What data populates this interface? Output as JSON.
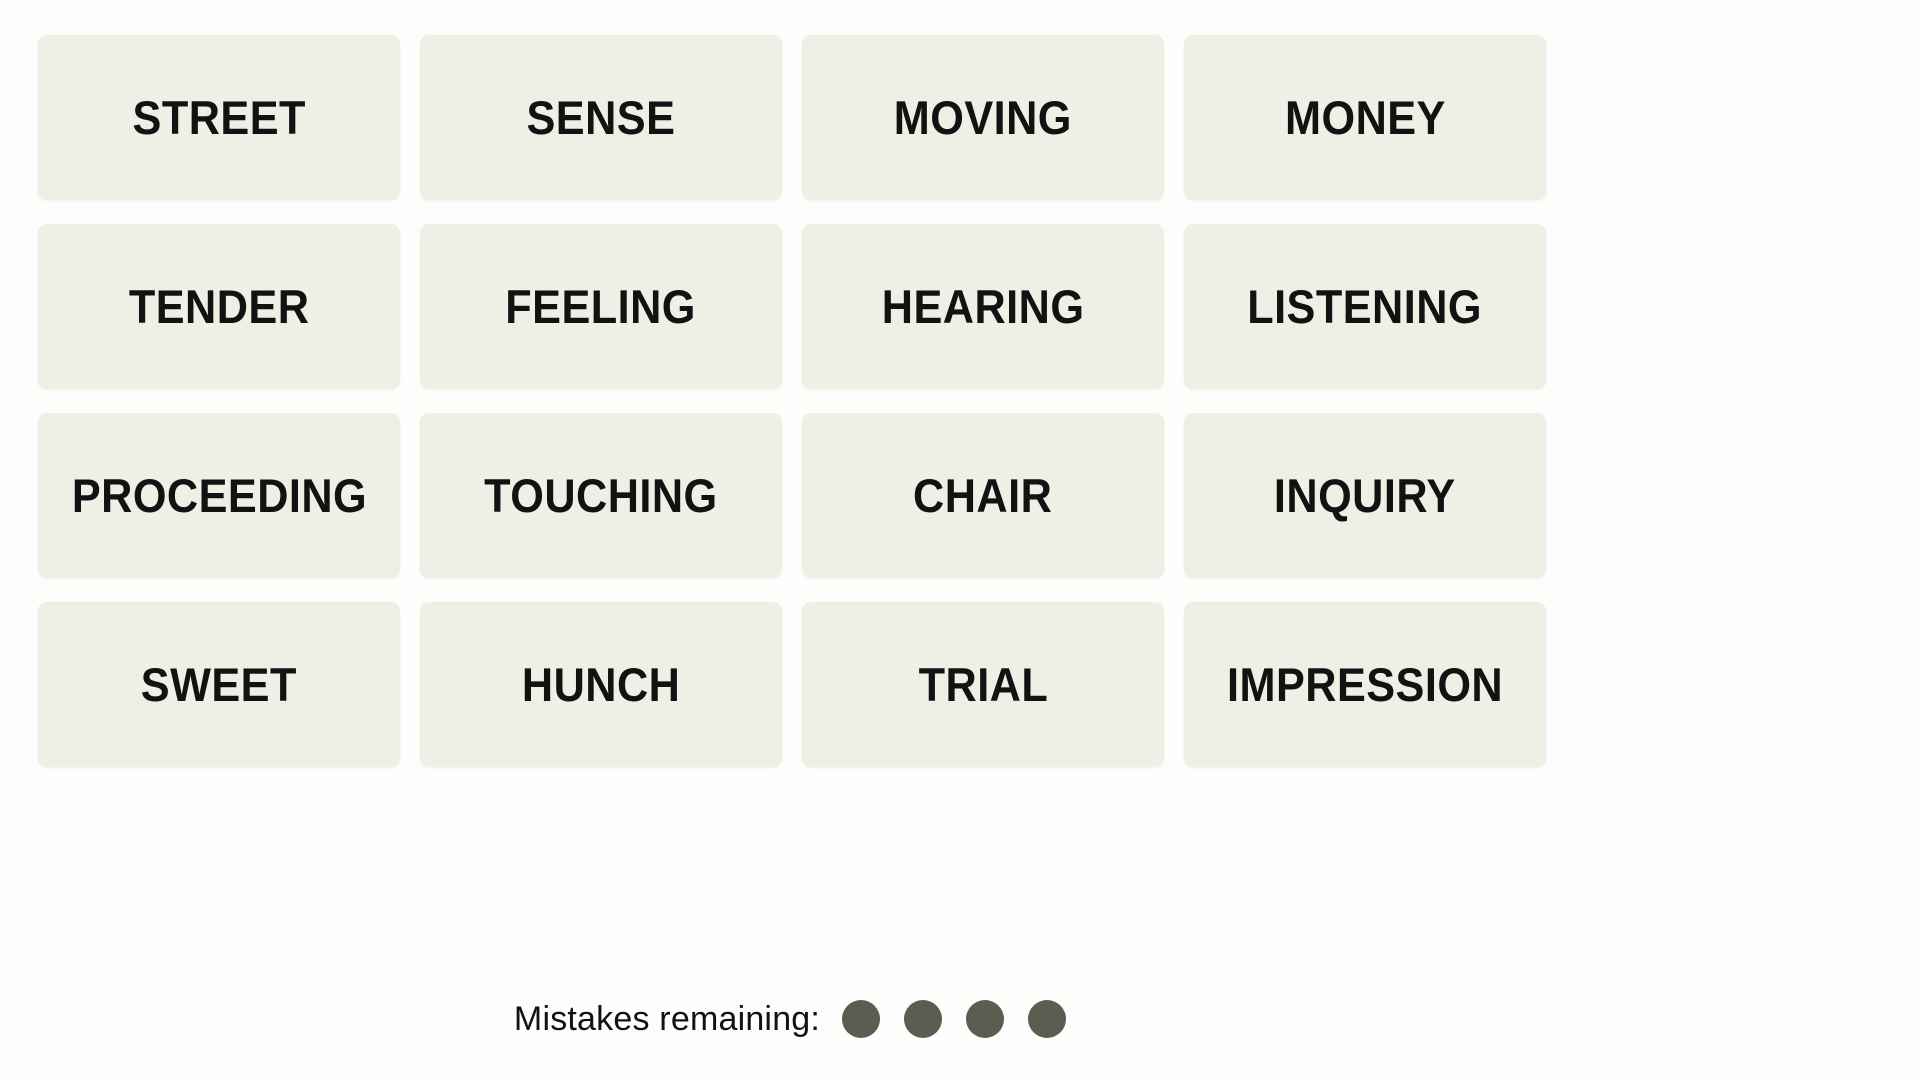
{
  "theme": {
    "page_background": "#fdfdfb",
    "tile_background": "#efefe6",
    "tile_text_color": "#121212",
    "mistake_dot_color": "#5a5d50",
    "mistakes_label_color": "#121212"
  },
  "board": {
    "columns": 4,
    "rows": 4,
    "rows_data": [
      {
        "cells": [
          {
            "word": "STREET"
          },
          {
            "word": "SENSE"
          },
          {
            "word": "MOVING"
          },
          {
            "word": "MONEY"
          }
        ]
      },
      {
        "cells": [
          {
            "word": "TENDER"
          },
          {
            "word": "FEELING"
          },
          {
            "word": "HEARING"
          },
          {
            "word": "LISTENING"
          }
        ]
      },
      {
        "cells": [
          {
            "word": "PROCEEDING"
          },
          {
            "word": "TOUCHING"
          },
          {
            "word": "CHAIR"
          },
          {
            "word": "INQUIRY"
          }
        ]
      },
      {
        "cells": [
          {
            "word": "SWEET"
          },
          {
            "word": "HUNCH"
          },
          {
            "word": "TRIAL"
          },
          {
            "word": "IMPRESSION"
          }
        ]
      }
    ]
  },
  "mistakes": {
    "label": "Mistakes remaining:",
    "remaining": 4,
    "dots": [
      {
        "state": "filled"
      },
      {
        "state": "filled"
      },
      {
        "state": "filled"
      },
      {
        "state": "filled"
      }
    ]
  }
}
